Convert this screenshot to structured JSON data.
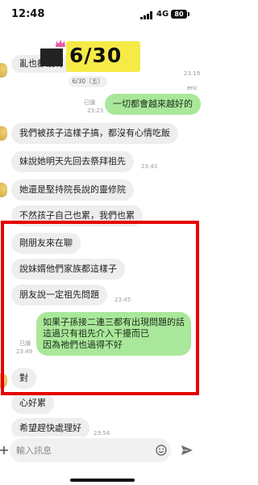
{
  "status_bar": {
    "time": "12:48",
    "network": "4G",
    "battery": "80"
  },
  "header_sticker": {
    "date_text": "6/30"
  },
  "chat": {
    "partial_top_message": "亂也都沒有",
    "partial_top_time": "23:19",
    "date_divider": "6/30（五）",
    "sender_name": "eric",
    "messages": [
      {
        "side": "out",
        "text": "一切都會越來越好的",
        "read": "已讀",
        "time": "23:23"
      },
      {
        "side": "in",
        "text": "我們被孩子這樣子搞，都沒有心情吃飯",
        "time": ""
      },
      {
        "side": "in",
        "text": "妹說她明天先回去祭拜祖先",
        "time": "23:43"
      },
      {
        "side": "in",
        "text": "她還是堅持院長說的靈修院",
        "time": ""
      },
      {
        "side": "in",
        "text": "不然孩子自己也累，我們也累",
        "time": ""
      },
      {
        "side": "in",
        "text": "剛朋友來在聊",
        "time": ""
      },
      {
        "side": "in",
        "text": "說妹婿他們家族都這樣子",
        "time": ""
      },
      {
        "side": "in",
        "text": "朋友說一定祖先問題",
        "time": "23:45"
      },
      {
        "side": "out",
        "lines": [
          "如果子孫接二連三都有出現問題的話",
          "這過只有祖先介入干擾而已",
          "因為祂們也過得不好"
        ],
        "read": "已讀",
        "time": "23:49"
      },
      {
        "side": "in",
        "text": "對",
        "time": ""
      },
      {
        "side": "in",
        "text": "心好累",
        "time": ""
      },
      {
        "side": "in",
        "text": "希望趕快處理好",
        "time": "23:54"
      }
    ]
  },
  "input_bar": {
    "placeholder": "輸入訊息",
    "icons": [
      "plus-icon",
      "emoji-icon",
      "send-icon"
    ]
  },
  "colors": {
    "outgoing_bubble": "#a9e89a",
    "incoming_bubble": "#eeeeee",
    "highlight_border": "#e60000",
    "sticker_yellow": "#f6ea47"
  }
}
